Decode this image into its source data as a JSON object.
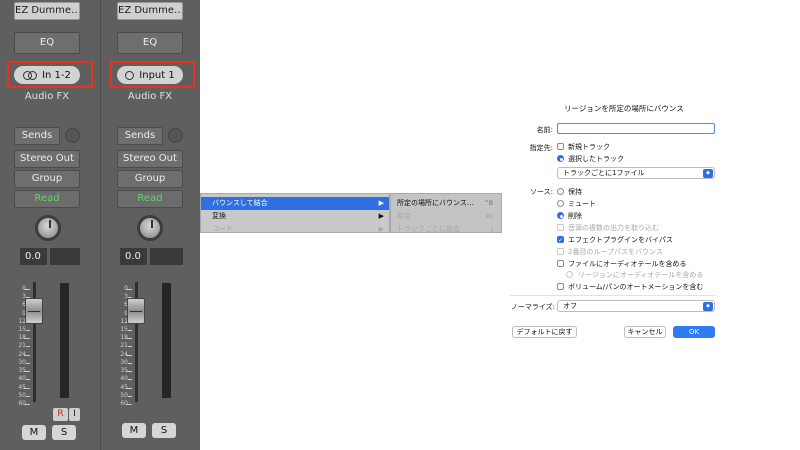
{
  "mixer": {
    "strips": [
      {
        "plugin": "EZ Dumme…",
        "eq": "EQ",
        "input": "In 1-2",
        "input_icon": "stereo-rings-icon",
        "effects": "Audio FX",
        "sends": "Sends",
        "output": "Stereo Out",
        "group": "Group",
        "automation": "Read",
        "volume": "0.0",
        "record": "R",
        "input_monitor": "I",
        "mute": "M",
        "solo": "S"
      },
      {
        "plugin": "EZ Dumme…",
        "eq": "EQ",
        "input": "Input 1",
        "input_icon": "mono-ring-icon",
        "effects": "Audio FX",
        "sends": "Sends",
        "output": "Stereo Out",
        "group": "Group",
        "automation": "Read",
        "volume": "0.0",
        "mute": "M",
        "solo": "S"
      }
    ],
    "scale_labels": [
      "0",
      "3",
      "6",
      "9",
      "12",
      "15",
      "18",
      "21",
      "24",
      "30",
      "35",
      "40",
      "45",
      "50",
      "60"
    ],
    "highlight_color": "#e8321f",
    "read_color": "#63d363"
  },
  "menu": {
    "items": [
      {
        "label": "バウンスして結合",
        "highlighted": true,
        "has_submenu": true
      },
      {
        "label": "変換",
        "has_submenu": true
      },
      {
        "label": "コード",
        "disabled": true,
        "has_submenu": true
      }
    ],
    "submenu": [
      {
        "label": "所定の場所にバウンス…",
        "shortcut": "^B"
      },
      {
        "label": "結合",
        "shortcut": "⌘J",
        "disabled": true
      },
      {
        "label": "トラックごとに結合",
        "shortcut": "J",
        "disabled": true
      }
    ]
  },
  "dialog": {
    "title": "リージョンを所定の場所にバウンス",
    "name_label": "名前:",
    "name_value": "",
    "destination_label": "指定先:",
    "destination_options": [
      {
        "label": "新規トラック",
        "selected": false
      },
      {
        "label": "選択したトラック",
        "selected": true
      }
    ],
    "destination_popup": "トラックごとに1ファイル",
    "source_label": "ソース:",
    "source_options": [
      {
        "label": "保持",
        "selected": false
      },
      {
        "label": "ミュート",
        "selected": false
      },
      {
        "label": "削除",
        "selected": true
      }
    ],
    "source_checks": [
      {
        "label": "音源の複数の出力を取り込む",
        "checked": false,
        "disabled": true
      },
      {
        "label": "エフェクトプラグインをバイパス",
        "checked": true,
        "disabled": false
      },
      {
        "label": "2番目のループパスをバウンス",
        "checked": false,
        "disabled": true
      },
      {
        "label": "ファイルにオーディオテールを含める",
        "checked": false,
        "disabled": false
      },
      {
        "label": "リージョンにオーディオテールを含める",
        "checked": false,
        "disabled": true,
        "radio": true
      },
      {
        "label": "ボリューム/パンのオートメーションを含む",
        "checked": false,
        "disabled": false
      }
    ],
    "normalize_label": "ノーマライズ:",
    "normalize_value": "オフ",
    "default_button": "デフォルトに戻す",
    "cancel_button": "キャンセル",
    "ok_button": "OK",
    "accent_color": "#2f6fe2"
  }
}
